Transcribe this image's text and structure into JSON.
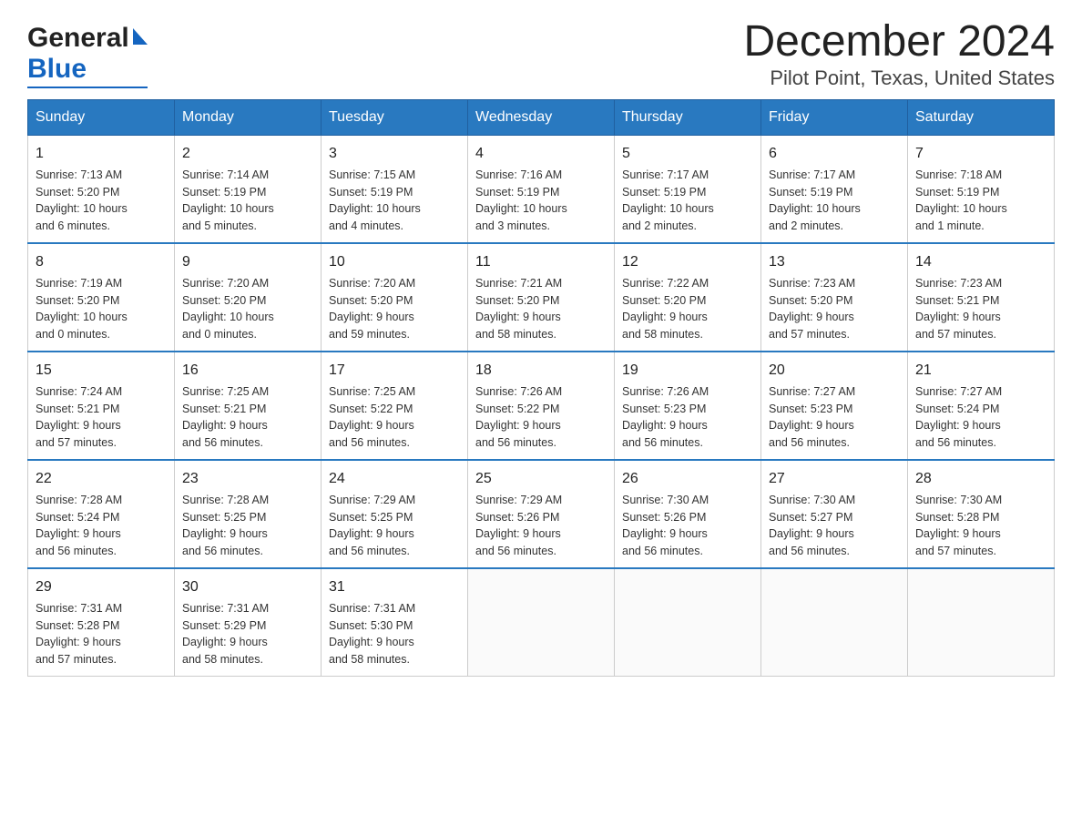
{
  "logo": {
    "general": "General",
    "blue": "Blue"
  },
  "title": "December 2024",
  "subtitle": "Pilot Point, Texas, United States",
  "days_of_week": [
    "Sunday",
    "Monday",
    "Tuesday",
    "Wednesday",
    "Thursday",
    "Friday",
    "Saturday"
  ],
  "weeks": [
    [
      {
        "day": "1",
        "info": "Sunrise: 7:13 AM\nSunset: 5:20 PM\nDaylight: 10 hours\nand 6 minutes."
      },
      {
        "day": "2",
        "info": "Sunrise: 7:14 AM\nSunset: 5:19 PM\nDaylight: 10 hours\nand 5 minutes."
      },
      {
        "day": "3",
        "info": "Sunrise: 7:15 AM\nSunset: 5:19 PM\nDaylight: 10 hours\nand 4 minutes."
      },
      {
        "day": "4",
        "info": "Sunrise: 7:16 AM\nSunset: 5:19 PM\nDaylight: 10 hours\nand 3 minutes."
      },
      {
        "day": "5",
        "info": "Sunrise: 7:17 AM\nSunset: 5:19 PM\nDaylight: 10 hours\nand 2 minutes."
      },
      {
        "day": "6",
        "info": "Sunrise: 7:17 AM\nSunset: 5:19 PM\nDaylight: 10 hours\nand 2 minutes."
      },
      {
        "day": "7",
        "info": "Sunrise: 7:18 AM\nSunset: 5:19 PM\nDaylight: 10 hours\nand 1 minute."
      }
    ],
    [
      {
        "day": "8",
        "info": "Sunrise: 7:19 AM\nSunset: 5:20 PM\nDaylight: 10 hours\nand 0 minutes."
      },
      {
        "day": "9",
        "info": "Sunrise: 7:20 AM\nSunset: 5:20 PM\nDaylight: 10 hours\nand 0 minutes."
      },
      {
        "day": "10",
        "info": "Sunrise: 7:20 AM\nSunset: 5:20 PM\nDaylight: 9 hours\nand 59 minutes."
      },
      {
        "day": "11",
        "info": "Sunrise: 7:21 AM\nSunset: 5:20 PM\nDaylight: 9 hours\nand 58 minutes."
      },
      {
        "day": "12",
        "info": "Sunrise: 7:22 AM\nSunset: 5:20 PM\nDaylight: 9 hours\nand 58 minutes."
      },
      {
        "day": "13",
        "info": "Sunrise: 7:23 AM\nSunset: 5:20 PM\nDaylight: 9 hours\nand 57 minutes."
      },
      {
        "day": "14",
        "info": "Sunrise: 7:23 AM\nSunset: 5:21 PM\nDaylight: 9 hours\nand 57 minutes."
      }
    ],
    [
      {
        "day": "15",
        "info": "Sunrise: 7:24 AM\nSunset: 5:21 PM\nDaylight: 9 hours\nand 57 minutes."
      },
      {
        "day": "16",
        "info": "Sunrise: 7:25 AM\nSunset: 5:21 PM\nDaylight: 9 hours\nand 56 minutes."
      },
      {
        "day": "17",
        "info": "Sunrise: 7:25 AM\nSunset: 5:22 PM\nDaylight: 9 hours\nand 56 minutes."
      },
      {
        "day": "18",
        "info": "Sunrise: 7:26 AM\nSunset: 5:22 PM\nDaylight: 9 hours\nand 56 minutes."
      },
      {
        "day": "19",
        "info": "Sunrise: 7:26 AM\nSunset: 5:23 PM\nDaylight: 9 hours\nand 56 minutes."
      },
      {
        "day": "20",
        "info": "Sunrise: 7:27 AM\nSunset: 5:23 PM\nDaylight: 9 hours\nand 56 minutes."
      },
      {
        "day": "21",
        "info": "Sunrise: 7:27 AM\nSunset: 5:24 PM\nDaylight: 9 hours\nand 56 minutes."
      }
    ],
    [
      {
        "day": "22",
        "info": "Sunrise: 7:28 AM\nSunset: 5:24 PM\nDaylight: 9 hours\nand 56 minutes."
      },
      {
        "day": "23",
        "info": "Sunrise: 7:28 AM\nSunset: 5:25 PM\nDaylight: 9 hours\nand 56 minutes."
      },
      {
        "day": "24",
        "info": "Sunrise: 7:29 AM\nSunset: 5:25 PM\nDaylight: 9 hours\nand 56 minutes."
      },
      {
        "day": "25",
        "info": "Sunrise: 7:29 AM\nSunset: 5:26 PM\nDaylight: 9 hours\nand 56 minutes."
      },
      {
        "day": "26",
        "info": "Sunrise: 7:30 AM\nSunset: 5:26 PM\nDaylight: 9 hours\nand 56 minutes."
      },
      {
        "day": "27",
        "info": "Sunrise: 7:30 AM\nSunset: 5:27 PM\nDaylight: 9 hours\nand 56 minutes."
      },
      {
        "day": "28",
        "info": "Sunrise: 7:30 AM\nSunset: 5:28 PM\nDaylight: 9 hours\nand 57 minutes."
      }
    ],
    [
      {
        "day": "29",
        "info": "Sunrise: 7:31 AM\nSunset: 5:28 PM\nDaylight: 9 hours\nand 57 minutes."
      },
      {
        "day": "30",
        "info": "Sunrise: 7:31 AM\nSunset: 5:29 PM\nDaylight: 9 hours\nand 58 minutes."
      },
      {
        "day": "31",
        "info": "Sunrise: 7:31 AM\nSunset: 5:30 PM\nDaylight: 9 hours\nand 58 minutes."
      },
      {
        "day": "",
        "info": ""
      },
      {
        "day": "",
        "info": ""
      },
      {
        "day": "",
        "info": ""
      },
      {
        "day": "",
        "info": ""
      }
    ]
  ]
}
